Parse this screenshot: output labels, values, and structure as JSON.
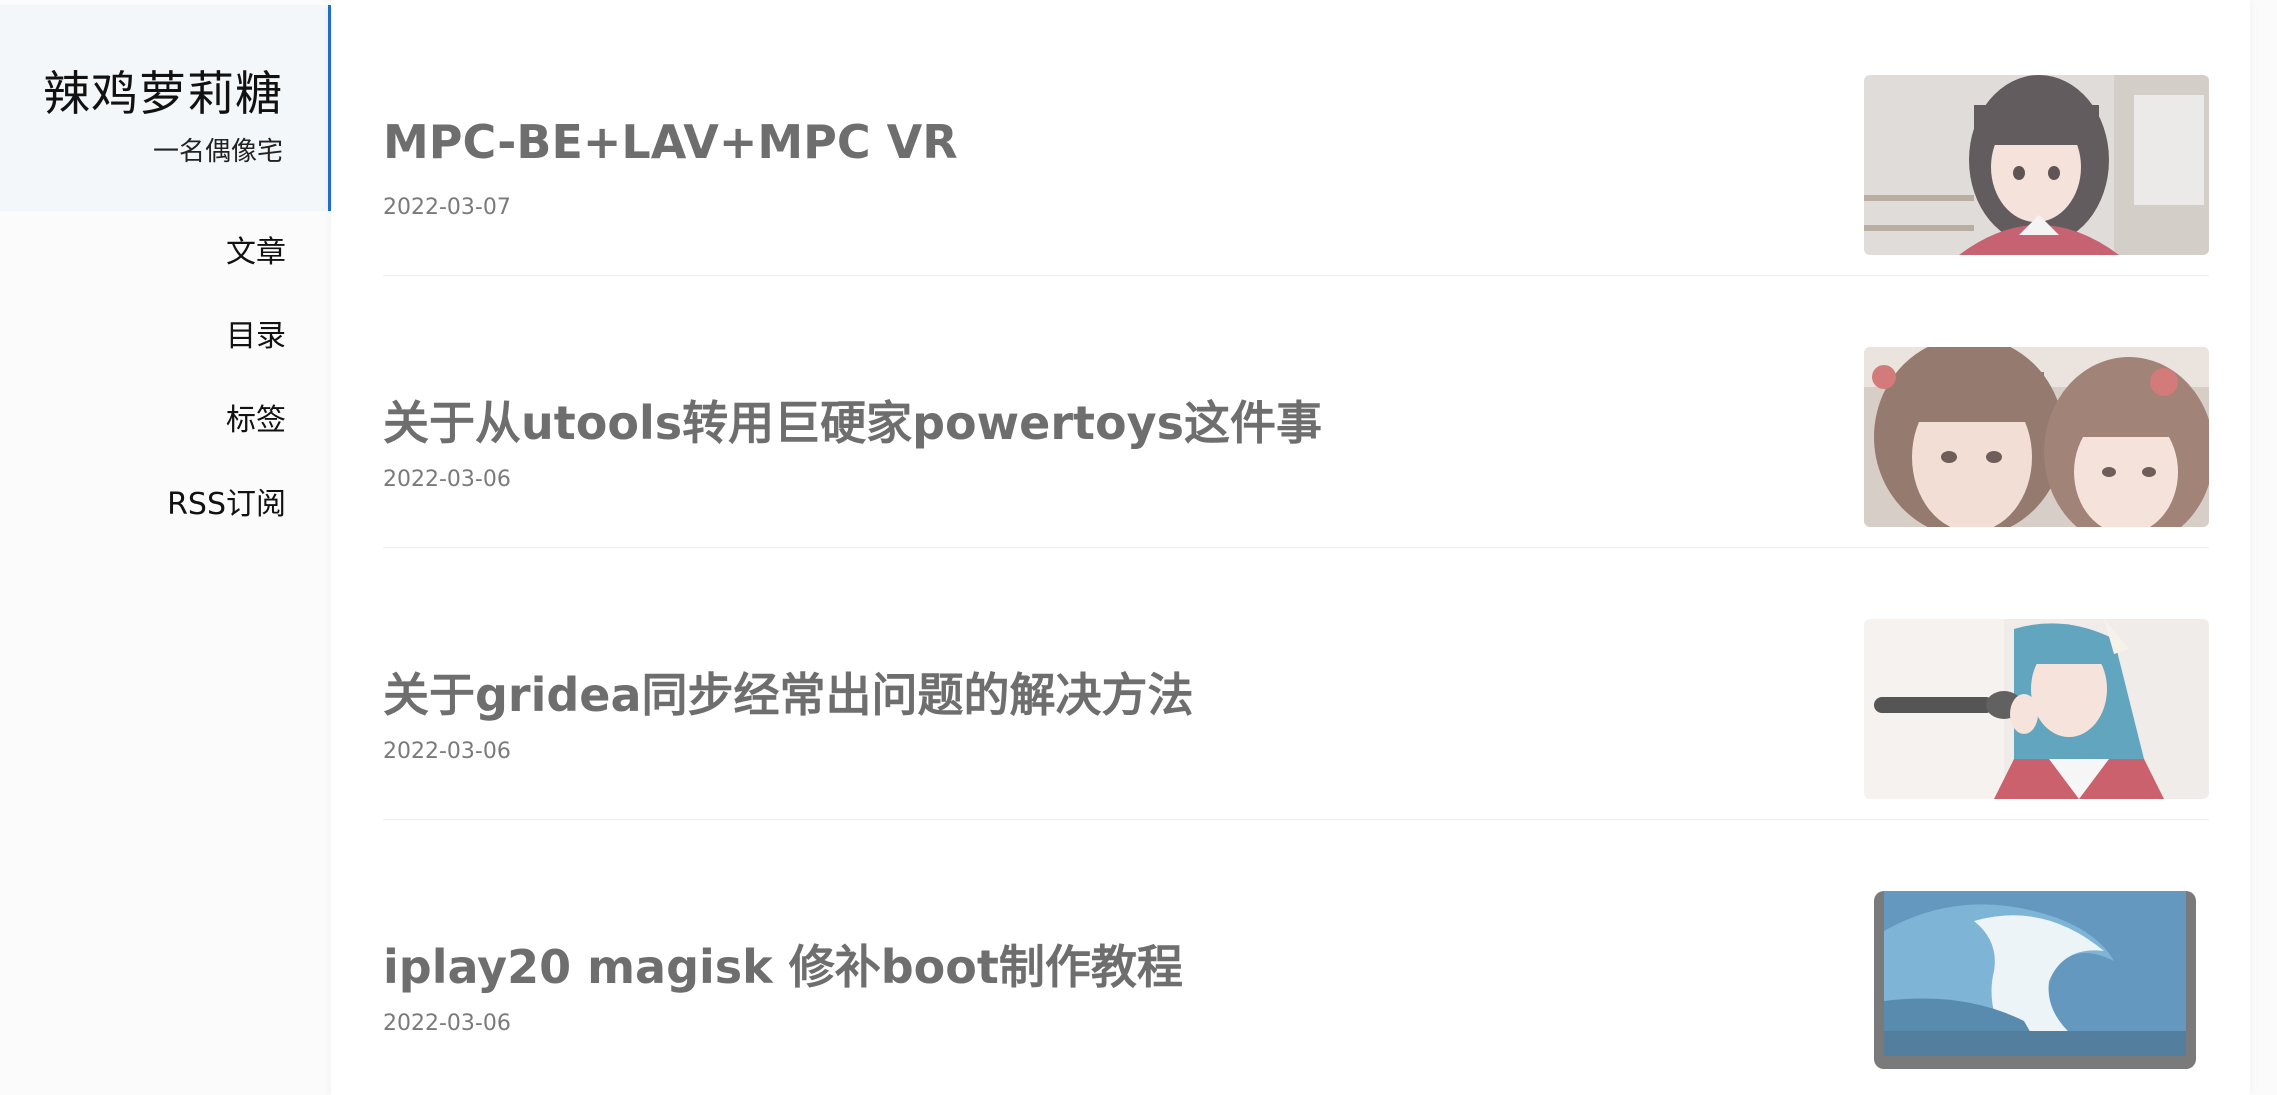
{
  "sidebar": {
    "brand_title": "辣鸡萝莉糖",
    "brand_subtitle": "一名偶像宅",
    "nav": [
      {
        "label": "文章"
      },
      {
        "label": "目录"
      },
      {
        "label": "标签"
      },
      {
        "label": "RSS订阅"
      }
    ]
  },
  "posts": [
    {
      "title": "MPC-BE+LAV+MPC VR",
      "date": "2022-03-07",
      "thumb_icon": "photo-girl-twintails"
    },
    {
      "title": "关于从utools转用巨硬家powertoys这件事",
      "date": "2022-03-06",
      "thumb_icon": "photo-two-girls"
    },
    {
      "title": "关于gridea同步经常出问题的解决方法",
      "date": "2022-03-06",
      "thumb_icon": "photo-girl-microphone"
    },
    {
      "title": "iplay20 magisk 修补boot制作教程",
      "date": "2022-03-06",
      "thumb_icon": "photo-tablet-wave"
    }
  ],
  "colors": {
    "accent": "#1f6fd1",
    "title_text": "#6e6e6e",
    "date_text": "#7a7a7a"
  }
}
